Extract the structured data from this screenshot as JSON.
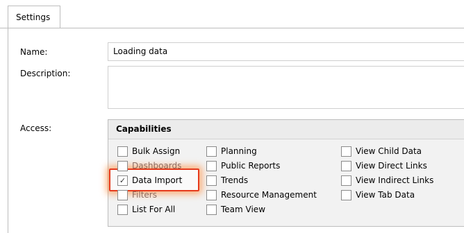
{
  "tabs": [
    {
      "label": "Settings"
    }
  ],
  "form": {
    "name_label": "Name:",
    "name_value": "Loading data",
    "description_label": "Description:",
    "description_value": "",
    "access_label": "Access:"
  },
  "capabilities": {
    "title": "Capabilities",
    "columns": [
      [
        {
          "label": "Bulk Assign",
          "checked": false
        },
        {
          "label": "Dashboards",
          "checked": false
        },
        {
          "label": "Data Import",
          "checked": true
        },
        {
          "label": "Filters",
          "checked": false
        },
        {
          "label": "List For All",
          "checked": false
        }
      ],
      [
        {
          "label": "Planning",
          "checked": false
        },
        {
          "label": "Public Reports",
          "checked": false
        },
        {
          "label": "Trends",
          "checked": false
        },
        {
          "label": "Resource Management",
          "checked": false
        },
        {
          "label": "Team View",
          "checked": false
        }
      ],
      [
        {
          "label": "View Child Data",
          "checked": false
        },
        {
          "label": "View Direct Links",
          "checked": false
        },
        {
          "label": "View Indirect Links",
          "checked": false
        },
        {
          "label": "View Tab Data",
          "checked": false
        }
      ]
    ]
  },
  "icons": {
    "checkmark": "check-icon"
  },
  "colors": {
    "highlight": "#e63a1c"
  }
}
